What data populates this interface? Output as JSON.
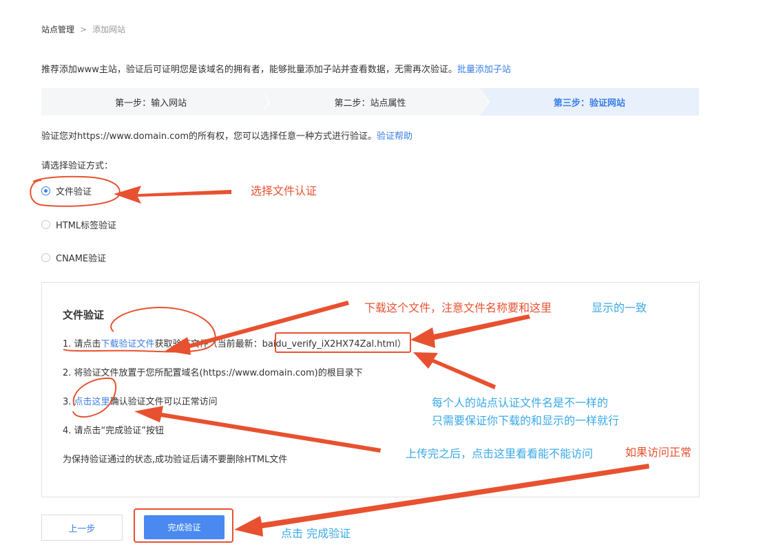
{
  "breadcrumb": {
    "root": "站点管理",
    "separator": ">",
    "current": "添加网站"
  },
  "intro": {
    "text": "推荐添加www主站，验证后可证明您是该域名的拥有者，能够批量添加子站并查看数据，无需再次验证。",
    "link": "批量添加子站"
  },
  "steps": [
    {
      "label": "第一步：输入网站",
      "active": false
    },
    {
      "label": "第二步：站点属性",
      "active": false
    },
    {
      "label": "第三步：验证网站",
      "active": true
    }
  ],
  "verify": {
    "desc": "验证您对https://www.domain.com的所有权，您可以选择任意一种方式进行验证。",
    "help_link": "验证帮助",
    "method_label": "请选择验证方式："
  },
  "methods": [
    {
      "label": "文件验证",
      "checked": true
    },
    {
      "label": "HTML标签验证",
      "checked": false
    },
    {
      "label": "CNAME验证",
      "checked": false
    }
  ],
  "panel": {
    "title": "文件验证",
    "step1_prefix": "1.  请点击",
    "step1_link": "下载验证文件",
    "step1_mid": "获取验证文件（当前最新：",
    "step1_file": "baidu_verify_iX2HX74Zal.html",
    "step1_suffix": "）",
    "step2": "2.  将验证文件放置于您所配置域名(https://www.domain.com)的根目录下",
    "step3_prefix": "3.  ",
    "step3_link": "点击这里",
    "step3_suffix": "确认验证文件可以正常访问",
    "step4": "4.  请点击“完成验证”按钮",
    "note": "为保持验证通过的状态,成功验证后请不要删除HTML文件"
  },
  "buttons": {
    "prev": "上一步",
    "finish": "完成验证"
  },
  "annotations": {
    "select_file": "选择文件认证",
    "download_note": "下载这个文件，注意文件名称要和这里",
    "download_note_blue": "显示的一致",
    "each_site_1": "每个人的站点认证文件名是不一样的",
    "each_site_2": "只需要保证你下载的和显示的一样就行",
    "after_upload": "上传完之后，点击这里看看能不能访问",
    "if_ok": "如果访问正常",
    "click_finish": "点击 完成验证"
  },
  "colors": {
    "accent": "#3a7ee8",
    "annotation_red": "#e8512f",
    "annotation_blue": "#39a9e8"
  }
}
